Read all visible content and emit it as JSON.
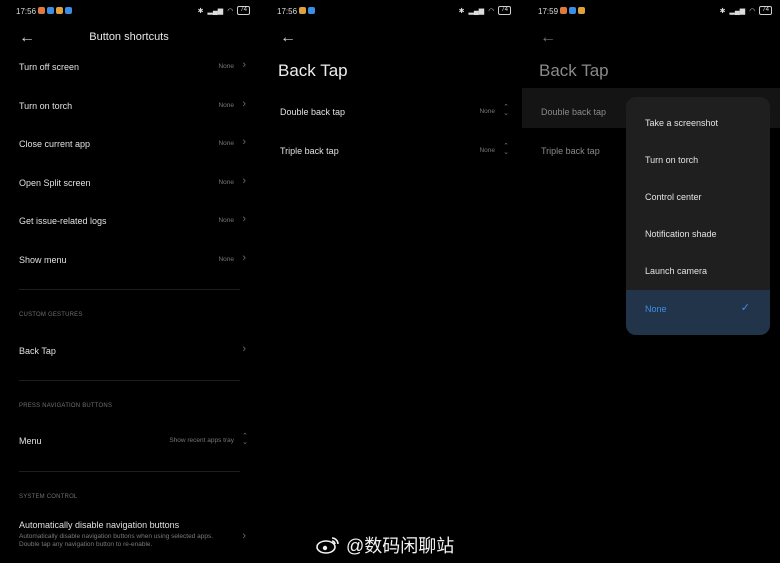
{
  "screen1": {
    "time": "17:56",
    "battery": "74",
    "title": "Button shortcuts",
    "rows": [
      {
        "label": "Turn off screen",
        "value": "None"
      },
      {
        "label": "Turn on torch",
        "value": "None"
      },
      {
        "label": "Close current app",
        "value": "None"
      },
      {
        "label": "Open Split screen",
        "value": "None"
      },
      {
        "label": "Get issue-related logs",
        "value": "None"
      },
      {
        "label": "Show menu",
        "value": "None"
      }
    ],
    "section_custom": "CUSTOM GESTURES",
    "back_tap": "Back Tap",
    "section_nav": "PRESS NAVIGATION BUTTONS",
    "menu_label": "Menu",
    "menu_value": "Show recent apps tray",
    "section_system": "SYSTEM CONTROL",
    "auto_disable_title": "Automatically disable navigation buttons",
    "auto_disable_desc": "Automatically disable navigation buttons when using selected apps. Double tap any navigation button to re-enable."
  },
  "screen2": {
    "time": "17:56",
    "battery": "74",
    "title": "Back Tap",
    "rows": [
      {
        "label": "Double back tap",
        "value": "None"
      },
      {
        "label": "Triple back tap",
        "value": "None"
      }
    ]
  },
  "screen3": {
    "time": "17:59",
    "battery": "74",
    "title": "Back Tap",
    "rows": [
      {
        "label": "Double back tap"
      },
      {
        "label": "Triple back tap"
      }
    ],
    "options": [
      "Take a screenshot",
      "Turn on torch",
      "Control center",
      "Notification shade",
      "Launch camera",
      "None"
    ],
    "selected_index": 5
  },
  "watermark": "@数码闲聊站",
  "colors": {
    "accent": "#3d8ee9",
    "popup_bg": "#1f1f1f",
    "selected_bg": "#223449"
  }
}
